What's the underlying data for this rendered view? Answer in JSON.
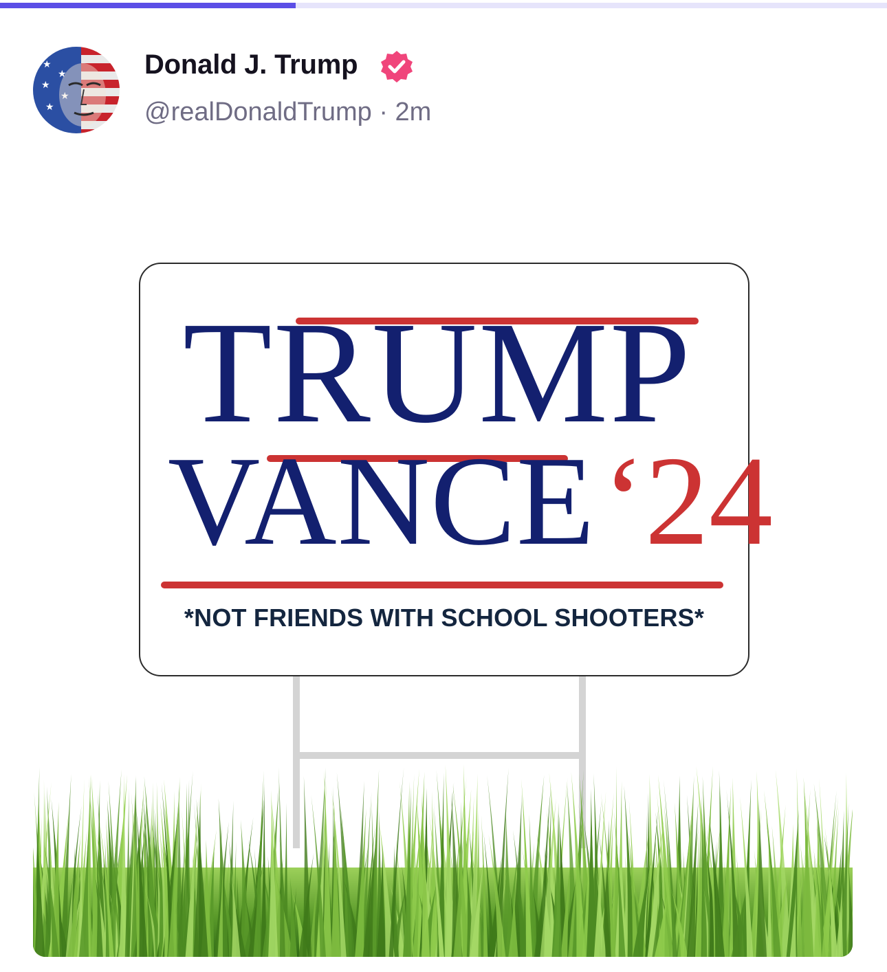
{
  "progress": {
    "fraction": 0.333,
    "fill_color": "#5b4ee6",
    "track_color": "#e6e4fb"
  },
  "post": {
    "author": {
      "display_name": "Donald J. Trump",
      "verified": true,
      "verified_icon": "verified-badge-icon",
      "badge_color": "#f0457b",
      "handle": "@realDonaldTrump",
      "separator": "·",
      "time_ago": "2m"
    },
    "media": {
      "sign": {
        "line1": "TRUMP",
        "line2": "VANCE",
        "year": "‘24",
        "tagline": "*NOT FRIENDS WITH SCHOOL SHOOTERS*",
        "blue": "#13206f",
        "red": "#cc3333"
      },
      "grass_color": "#5a9a2a"
    }
  }
}
